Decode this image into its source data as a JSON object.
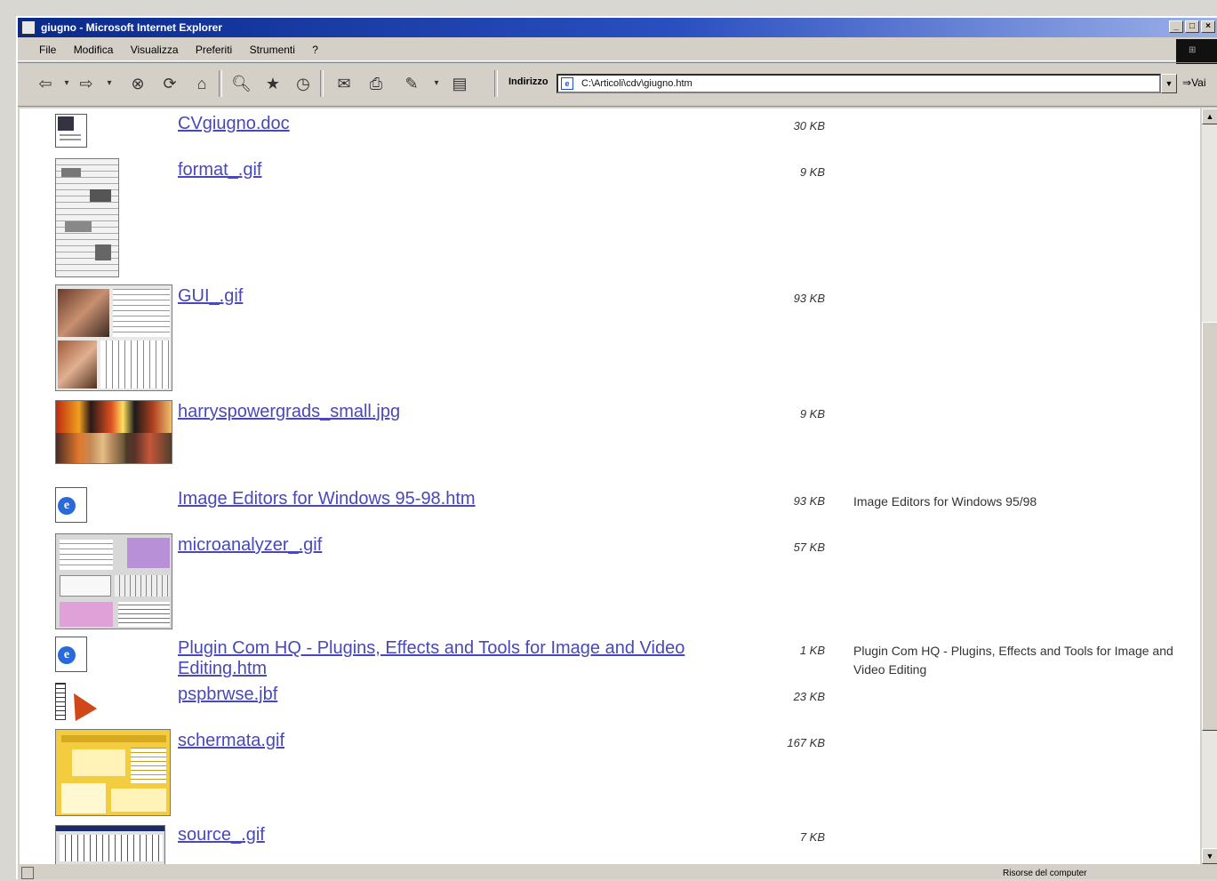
{
  "window": {
    "title": "giugno - Microsoft Internet Explorer"
  },
  "menu": [
    "File",
    "Modifica",
    "Visualizza",
    "Preferiti",
    "Strumenti",
    "?"
  ],
  "address": {
    "label": "Indirizzo",
    "value": "C:\\Articoli\\cdv\\giugno.htm",
    "go_label": "Vai"
  },
  "files": [
    {
      "name": "CVgiugno.doc",
      "size": "30 KB",
      "description": "",
      "thumb": "word-doc-icon"
    },
    {
      "name": "format_.gif",
      "size": "9 KB",
      "description": "",
      "thumb": "format-thumbnail"
    },
    {
      "name": "GUI_.gif",
      "size": "93 KB",
      "description": "",
      "thumb": "gui-thumbnail"
    },
    {
      "name": "harryspowergrads_small.jpg",
      "size": "9 KB",
      "description": "",
      "thumb": "gradients-thumbnail"
    },
    {
      "name": "Image Editors for Windows 95-98.htm",
      "size": "93 KB",
      "description": "Image Editors for Windows 95/98",
      "thumb": "ie-html-icon"
    },
    {
      "name": "microanalyzer_.gif",
      "size": "57 KB",
      "description": "",
      "thumb": "microanalyzer-thumbnail"
    },
    {
      "name": "Plugin Com HQ - Plugins, Effects and Tools for Image and Video Editing.htm",
      "size": "1 KB",
      "description": "Plugin Com HQ - Plugins, Effects and Tools for Image and Video Editing",
      "thumb": "ie-html-icon"
    },
    {
      "name": "pspbrwse.jbf",
      "size": "23 KB",
      "description": "",
      "thumb": "psp-browse-icon"
    },
    {
      "name": "schermata.gif",
      "size": "167 KB",
      "description": "",
      "thumb": "schermata-thumbnail"
    },
    {
      "name": "source_.gif",
      "size": "7 KB",
      "description": "",
      "thumb": "source-thumbnail"
    }
  ],
  "status": {
    "zone": "Risorse del computer"
  }
}
